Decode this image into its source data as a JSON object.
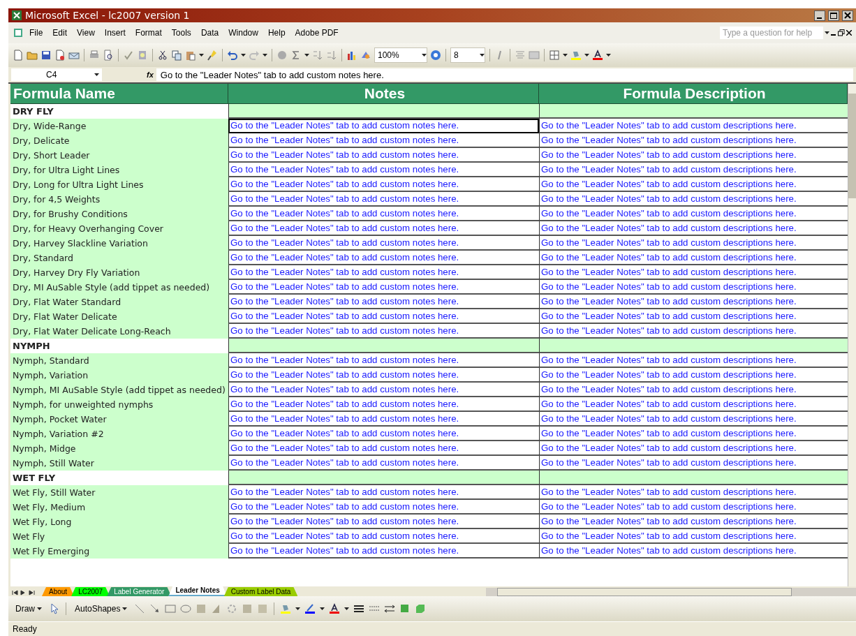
{
  "window": {
    "title": "Microsoft Excel - lc2007 version 1"
  },
  "menu": [
    "File",
    "Edit",
    "View",
    "Insert",
    "Format",
    "Tools",
    "Data",
    "Window",
    "Help",
    "Adobe PDF"
  ],
  "help_box": {
    "placeholder": "Type a question for help"
  },
  "toolbar": {
    "zoom": "100%",
    "font_size": "8"
  },
  "formula_bar": {
    "name_box": "C4",
    "fx": "fx",
    "value": "Go to the \"Leader Notes\" tab to add custom notes here."
  },
  "table": {
    "columns": [
      "Formula Name",
      "Notes",
      "Formula Description"
    ],
    "rows": [
      {
        "kind": "section",
        "name": "DRY FLY"
      },
      {
        "kind": "formula",
        "name": "Dry, Wide-Range",
        "notes": "Go to the \"Leader Notes\" tab to add custom notes here.",
        "description": "Go to the \"Leader Notes\" tab to add custom descriptions here.",
        "selected": true
      },
      {
        "kind": "formula",
        "name": "Dry, Delicate",
        "notes": "Go to the \"Leader Notes\" tab to add custom notes here.",
        "description": "Go to the \"Leader Notes\" tab to add custom descriptions here.",
        "selected": false
      },
      {
        "kind": "formula",
        "name": "Dry, Short Leader",
        "notes": "Go to the \"Leader Notes\" tab to add custom notes here.",
        "description": "Go to the \"Leader Notes\" tab to add custom descriptions here.",
        "selected": false
      },
      {
        "kind": "formula",
        "name": "Dry, for Ultra Light Lines",
        "notes": "Go to the \"Leader Notes\" tab to add custom notes here.",
        "description": "Go to the \"Leader Notes\" tab to add custom descriptions here.",
        "selected": false
      },
      {
        "kind": "formula",
        "name": "Dry, Long for Ultra Light Lines",
        "notes": "Go to the \"Leader Notes\" tab to add custom notes here.",
        "description": "Go to the \"Leader Notes\" tab to add custom descriptions here.",
        "selected": false
      },
      {
        "kind": "formula",
        "name": "Dry, for 4,5 Weights",
        "notes": "Go to the \"Leader Notes\" tab to add custom notes here.",
        "description": "Go to the \"Leader Notes\" tab to add custom descriptions here.",
        "selected": false
      },
      {
        "kind": "formula",
        "name": "Dry, for Brushy Conditions",
        "notes": "Go to the \"Leader Notes\" tab to add custom notes here.",
        "description": "Go to the \"Leader Notes\" tab to add custom descriptions here.",
        "selected": false
      },
      {
        "kind": "formula",
        "name": "Dry, for Heavy Overhanging Cover",
        "notes": "Go to the \"Leader Notes\" tab to add custom notes here.",
        "description": "Go to the \"Leader Notes\" tab to add custom descriptions here.",
        "selected": false
      },
      {
        "kind": "formula",
        "name": "Dry, Harvey Slackline Variation",
        "notes": "Go to the \"Leader Notes\" tab to add custom notes here.",
        "description": "Go to the \"Leader Notes\" tab to add custom descriptions here.",
        "selected": false
      },
      {
        "kind": "formula",
        "name": "Dry, Standard",
        "notes": "Go to the \"Leader Notes\" tab to add custom notes here.",
        "description": "Go to the \"Leader Notes\" tab to add custom descriptions here.",
        "selected": false
      },
      {
        "kind": "formula",
        "name": "Dry, Harvey Dry Fly Variation",
        "notes": "Go to the \"Leader Notes\" tab to add custom notes here.",
        "description": "Go to the \"Leader Notes\" tab to add custom descriptions here.",
        "selected": false
      },
      {
        "kind": "formula",
        "name": "Dry, MI AuSable Style (add tippet as needed)",
        "notes": "Go to the \"Leader Notes\" tab to add custom notes here.",
        "description": "Go to the \"Leader Notes\" tab to add custom descriptions here.",
        "selected": false
      },
      {
        "kind": "formula",
        "name": "Dry, Flat Water Standard",
        "notes": "Go to the \"Leader Notes\" tab to add custom notes here.",
        "description": "Go to the \"Leader Notes\" tab to add custom descriptions here.",
        "selected": false
      },
      {
        "kind": "formula",
        "name": "Dry, Flat Water Delicate",
        "notes": "Go to the \"Leader Notes\" tab to add custom notes here.",
        "description": "Go to the \"Leader Notes\" tab to add custom descriptions here.",
        "selected": false
      },
      {
        "kind": "formula",
        "name": "Dry, Flat Water Delicate Long-Reach",
        "notes": "Go to the \"Leader Notes\" tab to add custom notes here.",
        "description": "Go to the \"Leader Notes\" tab to add custom descriptions here.",
        "selected": false
      },
      {
        "kind": "section",
        "name": "NYMPH"
      },
      {
        "kind": "formula",
        "name": "Nymph, Standard",
        "notes": "Go to the \"Leader Notes\" tab to add custom notes here.",
        "description": "Go to the \"Leader Notes\" tab to add custom descriptions here.",
        "selected": false
      },
      {
        "kind": "formula",
        "name": "Nymph, Variation",
        "notes": "Go to the \"Leader Notes\" tab to add custom notes here.",
        "description": "Go to the \"Leader Notes\" tab to add custom descriptions here.",
        "selected": false
      },
      {
        "kind": "formula",
        "name": "Nymph, MI AuSable Style (add tippet as needed)",
        "notes": "Go to the \"Leader Notes\" tab to add custom notes here.",
        "description": "Go to the \"Leader Notes\" tab to add custom descriptions here.",
        "selected": false
      },
      {
        "kind": "formula",
        "name": "Nymph, for unweighted nymphs",
        "notes": "Go to the \"Leader Notes\" tab to add custom notes here.",
        "description": "Go to the \"Leader Notes\" tab to add custom descriptions here.",
        "selected": false
      },
      {
        "kind": "formula",
        "name": "Nymph, Pocket Water",
        "notes": "Go to the \"Leader Notes\" tab to add custom notes here.",
        "description": "Go to the \"Leader Notes\" tab to add custom descriptions here.",
        "selected": false
      },
      {
        "kind": "formula",
        "name": "Nymph, Variation #2",
        "notes": "Go to the \"Leader Notes\" tab to add custom notes here.",
        "description": "Go to the \"Leader Notes\" tab to add custom descriptions here.",
        "selected": false
      },
      {
        "kind": "formula",
        "name": "Nymph, Midge",
        "notes": "Go to the \"Leader Notes\" tab to add custom notes here.",
        "description": "Go to the \"Leader Notes\" tab to add custom descriptions here.",
        "selected": false
      },
      {
        "kind": "formula",
        "name": "Nymph, Still Water",
        "notes": "Go to the \"Leader Notes\" tab to add custom notes here.",
        "description": "Go to the \"Leader Notes\" tab to add custom descriptions here.",
        "selected": false
      },
      {
        "kind": "section",
        "name": "WET FLY"
      },
      {
        "kind": "formula",
        "name": "Wet Fly, Still Water",
        "notes": "Go to the \"Leader Notes\" tab to add custom notes here.",
        "description": "Go to the \"Leader Notes\" tab to add custom descriptions here.",
        "selected": false
      },
      {
        "kind": "formula",
        "name": "Wet Fly, Medium",
        "notes": "Go to the \"Leader Notes\" tab to add custom notes here.",
        "description": "Go to the \"Leader Notes\" tab to add custom descriptions here.",
        "selected": false
      },
      {
        "kind": "formula",
        "name": "Wet Fly, Long",
        "notes": "Go to the \"Leader Notes\" tab to add custom notes here.",
        "description": "Go to the \"Leader Notes\" tab to add custom descriptions here.",
        "selected": false
      },
      {
        "kind": "formula",
        "name": "Wet Fly",
        "notes": "Go to the \"Leader Notes\" tab to add custom notes here.",
        "description": "Go to the \"Leader Notes\" tab to add custom descriptions here.",
        "selected": false
      },
      {
        "kind": "formula",
        "name": "Wet Fly Emerging",
        "notes": "Go to the \"Leader Notes\" tab to add custom notes here.",
        "description": "Go to the \"Leader Notes\" tab to add custom descriptions here.",
        "selected": false
      }
    ]
  },
  "sheet_tabs": [
    {
      "label": "About",
      "selected": false,
      "color": "#ff9900"
    },
    {
      "label": "LC2007",
      "selected": false,
      "color": "#00ff00"
    },
    {
      "label": "Label Generator",
      "selected": false,
      "color": "#339966"
    },
    {
      "label": "Leader Notes",
      "selected": true,
      "color": "#ffffff"
    },
    {
      "label": "Custom Label Data",
      "selected": false,
      "color": "#99cc00"
    }
  ],
  "drawing_toolbar": {
    "draw": "Draw",
    "autoshapes": "AutoShapes"
  },
  "status_bar": {
    "text": "Ready"
  }
}
